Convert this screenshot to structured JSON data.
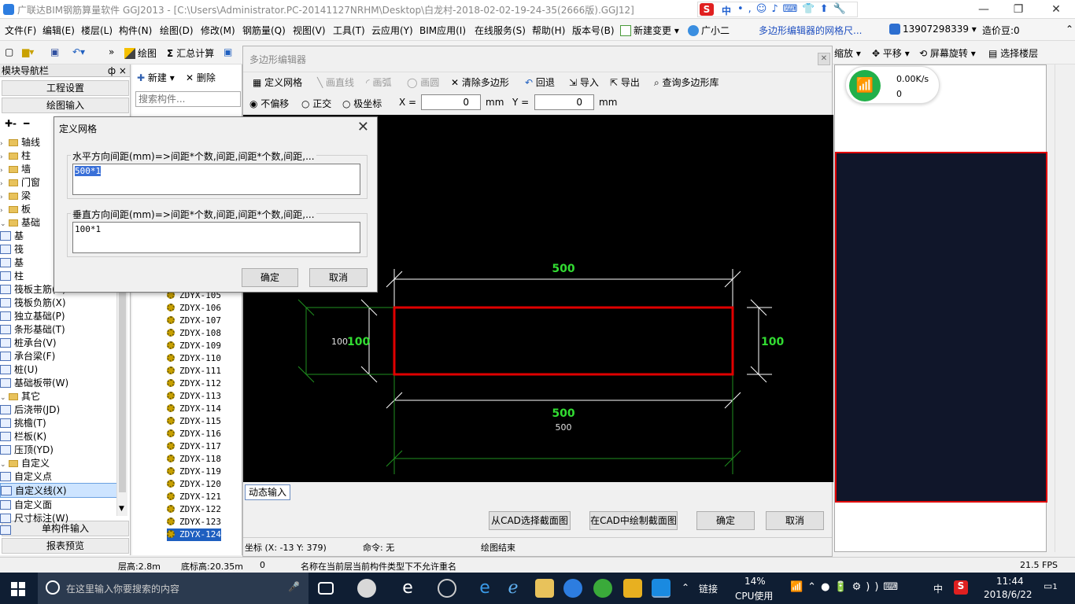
{
  "title": {
    "text": "广联达BIM钢筋算量软件 GGJ2013 - [C:\\Users\\Administrator.PC-20141127NRHM\\Desktop\\白龙村-2018-02-02-19-24-35(2666版).GGJ12]"
  },
  "ime": {
    "label": "中"
  },
  "menu": [
    "文件(F)",
    "编辑(E)",
    "楼层(L)",
    "构件(N)",
    "绘图(D)",
    "修改(M)",
    "钢筋量(Q)",
    "视图(V)",
    "工具(T)",
    "云应用(Y)",
    "BIM应用(I)",
    "在线服务(S)",
    "帮助(H)",
    "版本号(B)",
    "新建变更",
    "广小二"
  ],
  "menu_right": {
    "marquee": "多边形编辑器的网格尺...",
    "phone": "13907298339",
    "price": "造价豆:0"
  },
  "toolbar": {
    "draw": "绘图",
    "sum": "汇总计算",
    "zoom": "缩放",
    "pan": "平移",
    "rotate": "屏幕旋转",
    "select_floor": "选择楼层"
  },
  "left_panel": {
    "header": "模块导航栏",
    "pin": "ф ×",
    "project_settings": "工程设置",
    "drawing_input": "绘图输入",
    "single_input": "单构件输入",
    "report_preview": "报表预览",
    "tree": [
      {
        "label": "轴线",
        "level": 0,
        "kind": "folder"
      },
      {
        "label": "柱",
        "level": 0,
        "kind": "folder"
      },
      {
        "label": "墙",
        "level": 0,
        "kind": "folder"
      },
      {
        "label": "门窗",
        "level": 0,
        "kind": "folder"
      },
      {
        "label": "梁",
        "level": 0,
        "kind": "folder"
      },
      {
        "label": "板",
        "level": 0,
        "kind": "folder"
      },
      {
        "label": "基础",
        "level": 0,
        "kind": "folder",
        "open": true
      },
      {
        "label": "基",
        "level": 1,
        "kind": "item"
      },
      {
        "label": "筏",
        "level": 1,
        "kind": "item"
      },
      {
        "label": "基",
        "level": 1,
        "kind": "item"
      },
      {
        "label": "柱",
        "level": 1,
        "kind": "item"
      },
      {
        "label": "筏板主筋(R)",
        "level": 1,
        "kind": "item"
      },
      {
        "label": "筏板负筋(X)",
        "level": 1,
        "kind": "item"
      },
      {
        "label": "独立基础(P)",
        "level": 1,
        "kind": "item"
      },
      {
        "label": "条形基础(T)",
        "level": 1,
        "kind": "item"
      },
      {
        "label": "桩承台(V)",
        "level": 1,
        "kind": "item"
      },
      {
        "label": "承台梁(F)",
        "level": 1,
        "kind": "item"
      },
      {
        "label": "桩(U)",
        "level": 1,
        "kind": "item"
      },
      {
        "label": "基础板带(W)",
        "level": 1,
        "kind": "item"
      },
      {
        "label": "其它",
        "level": 0,
        "kind": "folder",
        "open": true
      },
      {
        "label": "后浇带(JD)",
        "level": 1,
        "kind": "item"
      },
      {
        "label": "挑檐(T)",
        "level": 1,
        "kind": "item"
      },
      {
        "label": "栏板(K)",
        "level": 1,
        "kind": "item"
      },
      {
        "label": "压顶(YD)",
        "level": 1,
        "kind": "item"
      },
      {
        "label": "自定义",
        "level": 0,
        "kind": "folder",
        "open": true
      },
      {
        "label": "自定义点",
        "level": 1,
        "kind": "item"
      },
      {
        "label": "自定义线(X)",
        "level": 1,
        "kind": "item",
        "selected": true
      },
      {
        "label": "自定义面",
        "level": 1,
        "kind": "item"
      },
      {
        "label": "尺寸标注(W)",
        "level": 1,
        "kind": "item"
      }
    ]
  },
  "component_panel": {
    "new": "新建",
    "delete": "删除",
    "search_placeholder": "搜索构件...",
    "items": [
      "ZDYX-105",
      "ZDYX-106",
      "ZDYX-107",
      "ZDYX-108",
      "ZDYX-109",
      "ZDYX-110",
      "ZDYX-111",
      "ZDYX-112",
      "ZDYX-113",
      "ZDYX-114",
      "ZDYX-115",
      "ZDYX-116",
      "ZDYX-117",
      "ZDYX-118",
      "ZDYX-119",
      "ZDYX-120",
      "ZDYX-121",
      "ZDYX-122",
      "ZDYX-123",
      "ZDYX-124"
    ],
    "selected": "ZDYX-124"
  },
  "editor": {
    "title": "多边形编辑器",
    "tools": {
      "define_grid": "定义网格",
      "draw_line": "画直线",
      "draw_arc": "画弧",
      "draw_circle": "画圆",
      "clear": "清除多边形",
      "undo": "回退",
      "import": "导入",
      "export": "导出",
      "query": "查询多边形库"
    },
    "offset": {
      "none": "不偏移",
      "ortho": "正交",
      "polar": "极坐标",
      "x_label": "X =",
      "x_value": "0",
      "y_label": "Y =",
      "y_value": "0",
      "unit": "mm"
    },
    "dims": {
      "top": "500",
      "left_white": "100",
      "left_green": "100",
      "right": "100",
      "bottom_green": "500",
      "bottom_white": "500"
    },
    "dynamic_input": "动态输入",
    "btn_cad_select": "从CAD选择截面图",
    "btn_cad_draw": "在CAD中绘制截面图",
    "btn_ok": "确定",
    "btn_cancel": "取消",
    "status_coord": "坐标 (X: -13 Y: 379)",
    "status_cmd": "命令: 无",
    "status_msg": "绘图结束"
  },
  "dialog": {
    "title": "定义网格",
    "h_label": "水平方向间距(mm)=>间距*个数,间距,间距*个数,间距,...",
    "h_value": "500*1",
    "v_label": "垂直方向间距(mm)=>间距*个数,间距,间距*个数,间距,...",
    "v_value": "100*1",
    "ok": "确定",
    "cancel": "取消"
  },
  "network": {
    "speed": "0.00K/s",
    "count": "0"
  },
  "statusbar": {
    "floor_height": "层高:2.8m",
    "base_height": "底标高:20.35m",
    "zero": "0",
    "msg": "名称在当前层当前构件类型下不允许重名",
    "fps": "21.5 FPS"
  },
  "taskbar": {
    "search": "在这里输入你要搜索的内容",
    "link": "链接",
    "cpu_pct": "14%",
    "cpu_label": "CPU使用",
    "ime": "中",
    "time": "11:44",
    "date": "2018/6/22",
    "notif": "1"
  },
  "colors": {
    "cad_bg": "#000000",
    "dim_green": "#32dc32",
    "rect_red": "#e00000",
    "accent": "#2d7de0",
    "taskbar": "#0f1e33"
  }
}
